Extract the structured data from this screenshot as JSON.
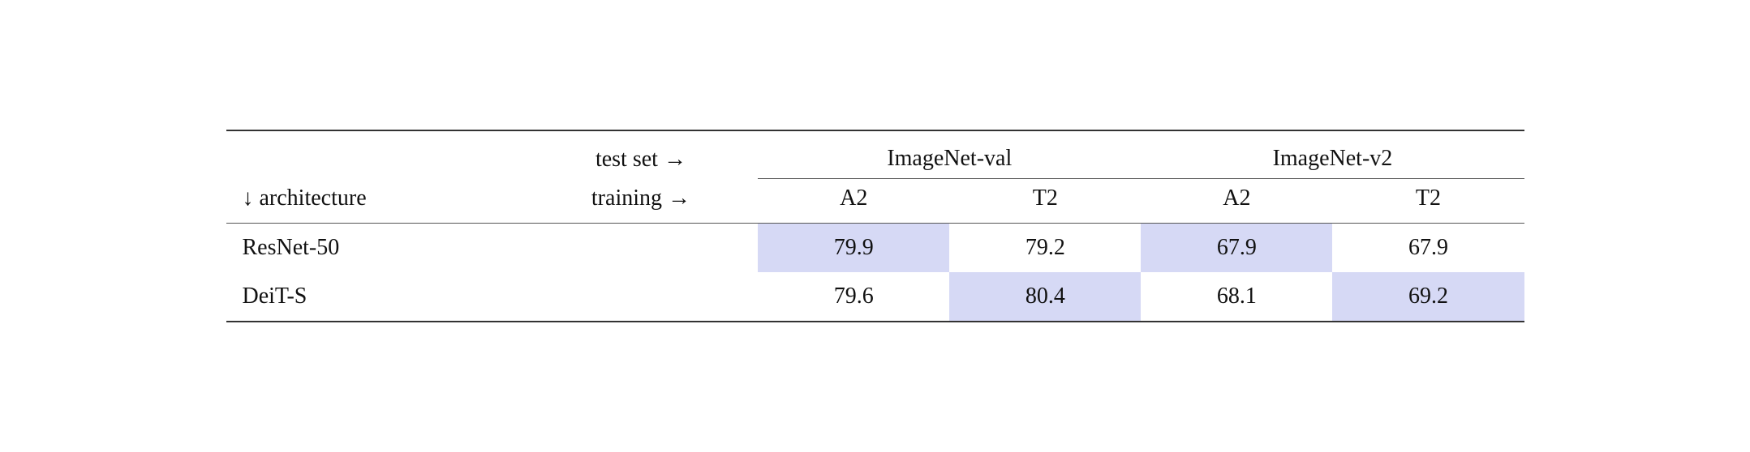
{
  "table": {
    "test_set_label": "test set →",
    "arch_label": "↓  architecture",
    "training_label": "training →",
    "imagenet_val_label": "ImageNet-val",
    "imagenet_v2_label": "ImageNet-v2",
    "col_a2": "A2",
    "col_t2": "T2",
    "rows": [
      {
        "arch": "ResNet-50",
        "val_a2": "79.9",
        "val_t2": "79.2",
        "v2_a2": "67.9",
        "v2_t2": "67.9",
        "highlight_val_a2": true,
        "highlight_val_t2": false,
        "highlight_v2_a2": true,
        "highlight_v2_t2": false
      },
      {
        "arch": "DeiT-S",
        "val_a2": "79.6",
        "val_t2": "80.4",
        "v2_a2": "68.1",
        "v2_t2": "69.2",
        "highlight_val_a2": false,
        "highlight_val_t2": true,
        "highlight_v2_a2": false,
        "highlight_v2_t2": true
      }
    ]
  }
}
